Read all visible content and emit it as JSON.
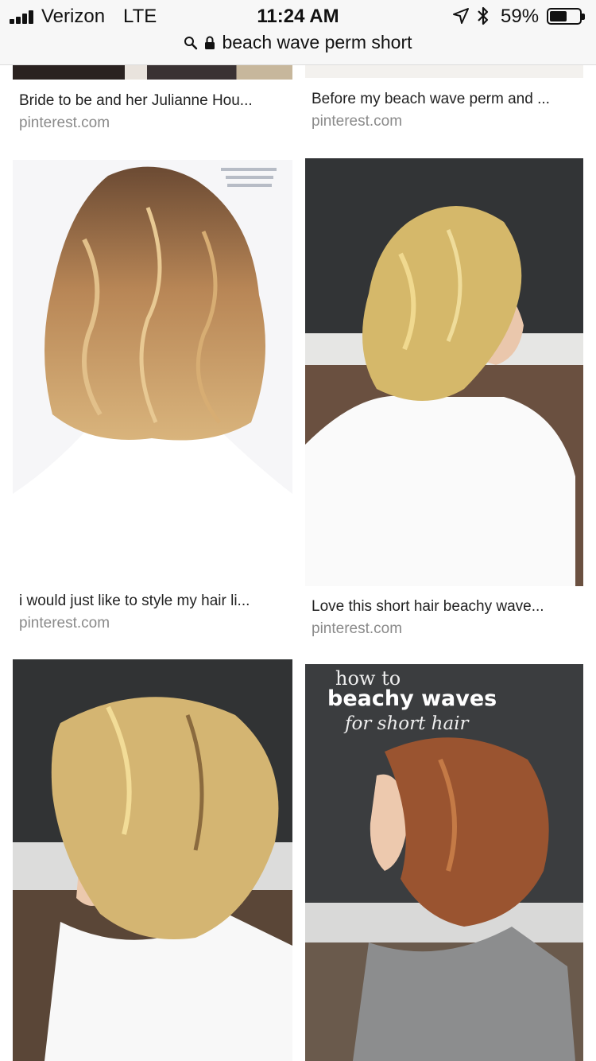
{
  "status_bar": {
    "carrier": "Verizon",
    "network": "LTE",
    "time": "11:24 AM",
    "battery_percent": "59%",
    "battery_level": 0.59,
    "icons": [
      "signal-icon",
      "location-arrow-icon",
      "bluetooth-icon",
      "battery-icon"
    ]
  },
  "url_bar": {
    "query": "beach wave perm short",
    "icons": [
      "search-icon",
      "lock-icon"
    ]
  },
  "results": [
    {
      "title": "Bride to be and her Julianne Hou...",
      "source": "pinterest.com"
    },
    {
      "title": "Before my beach wave perm and ...",
      "source": "pinterest.com"
    },
    {
      "title": "i would just like to style my hair li...",
      "source": "pinterest.com"
    },
    {
      "title": "Love this short hair beachy wave...",
      "source": "pinterest.com"
    },
    {
      "image_text": [
        "how to",
        "beachy waves",
        "for short hair"
      ]
    }
  ],
  "colors": {
    "bar_bg": "#f7f7f7",
    "title_text": "#222222",
    "source_text": "#8a8a8a"
  }
}
